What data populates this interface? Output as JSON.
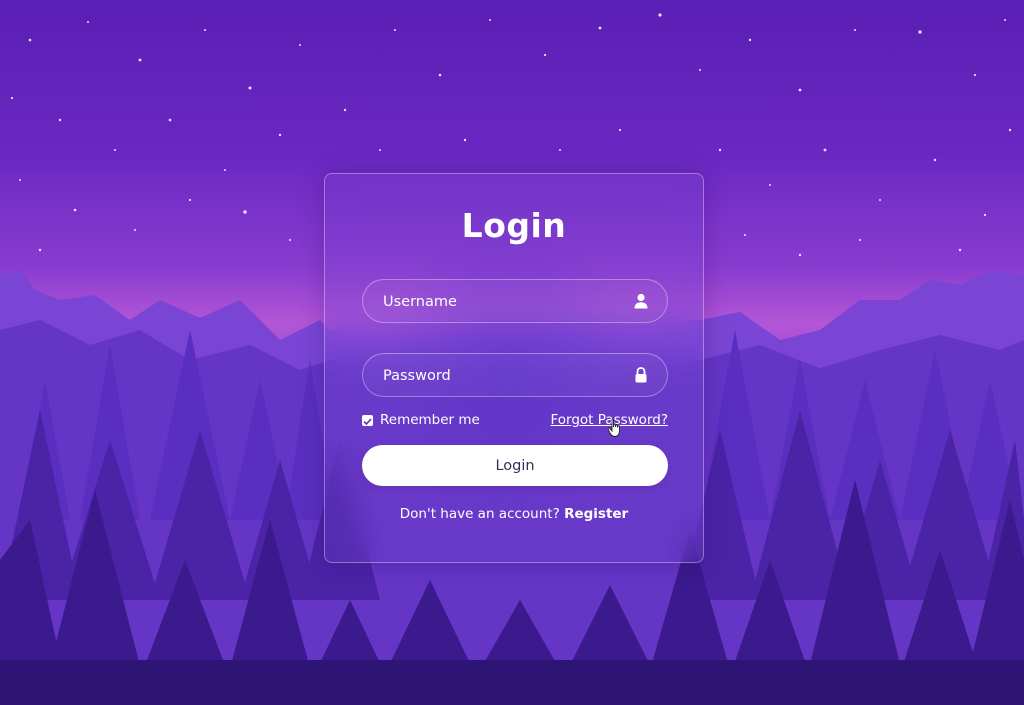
{
  "login": {
    "title": "Login",
    "username_placeholder": "Username",
    "password_placeholder": "Password",
    "remember_label": "Remember me",
    "remember_checked": true,
    "forgot_label": "Forgot Password?",
    "button_label": "Login",
    "register_prompt": "Don't have an account?",
    "register_label": "Register"
  },
  "icons": {
    "username": "user-icon",
    "password": "lock-icon"
  },
  "colors": {
    "sky_top": "#5a1fb4",
    "horizon": "#b356d6",
    "forest": "#3a1a8c",
    "button_bg": "#ffffff",
    "text": "#ffffff"
  }
}
